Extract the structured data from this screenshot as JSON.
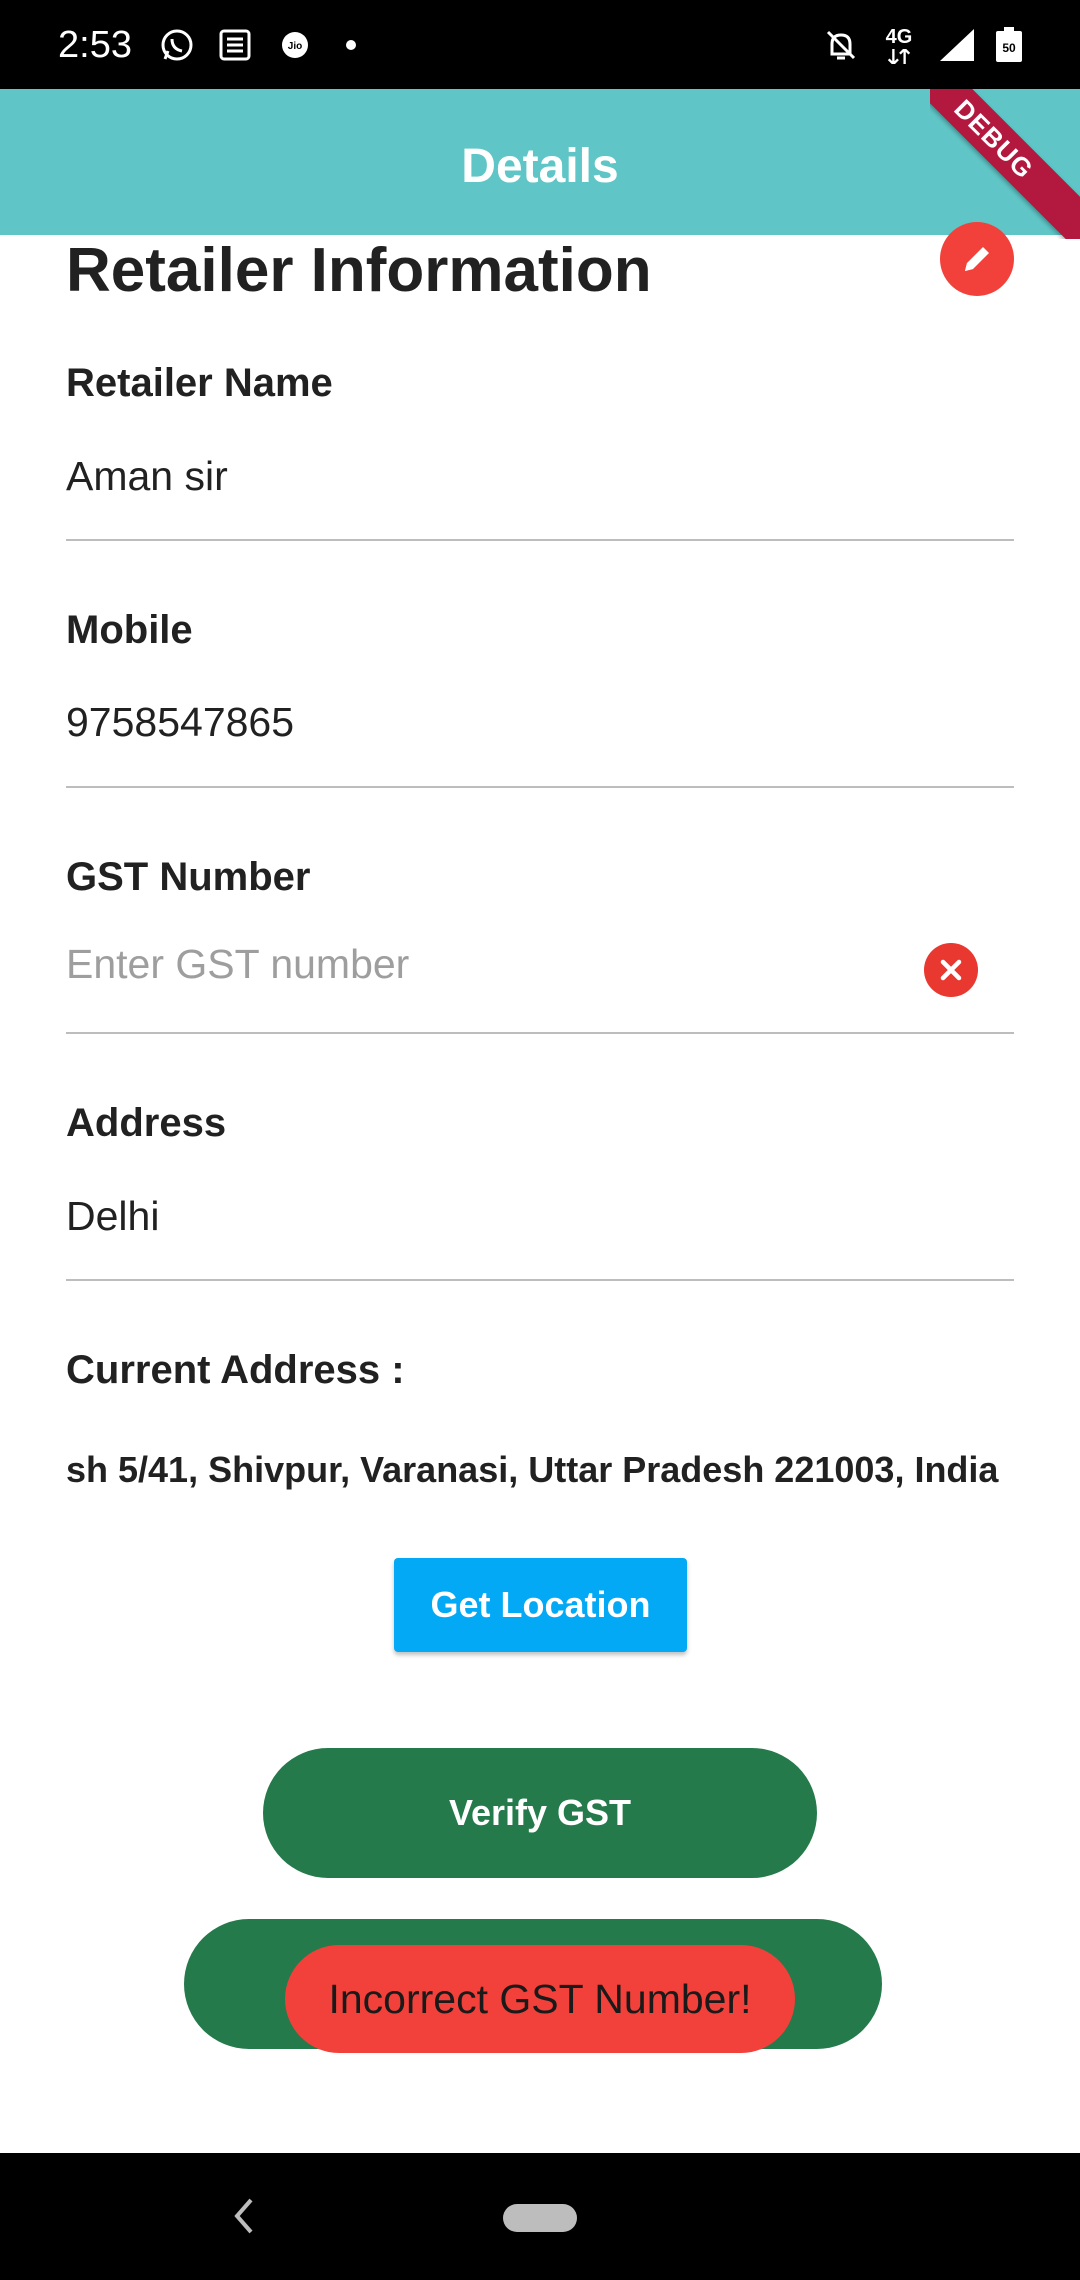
{
  "status_bar": {
    "time": "2:53",
    "left_icons": [
      "whatsapp-icon",
      "news-icon",
      "jio-icon"
    ],
    "right_icons": [
      "notifications-off-icon",
      "network-4g-icon",
      "signal-icon",
      "battery-icon"
    ],
    "network_label": "4G",
    "battery_label": "50"
  },
  "app_bar": {
    "title": "Details",
    "debug_label": "DEBUG",
    "background_color": "#5fc5c6"
  },
  "form": {
    "section_title": "Retailer Information",
    "fields": [
      {
        "label": "Retailer Name",
        "value": "Aman sir"
      },
      {
        "label": "Mobile",
        "value": "9758547865"
      },
      {
        "label": "GST Number",
        "value": "",
        "placeholder": "Enter GST number",
        "error": true
      },
      {
        "label": "Address",
        "value": "Delhi"
      }
    ],
    "current_address_label": "Current Address :",
    "current_address_value": "sh 5/41, Shivpur, Varanasi, Uttar Pradesh 221003, India"
  },
  "buttons": {
    "get_location": "Get Location",
    "verify_gst": "Verify GST",
    "submit": ""
  },
  "toast": {
    "message": "Incorrect GST Number!",
    "color": "#f2413a"
  },
  "colors": {
    "accent_green": "#247a4a",
    "accent_blue": "#03a9f4",
    "error_red": "#e8382f"
  }
}
